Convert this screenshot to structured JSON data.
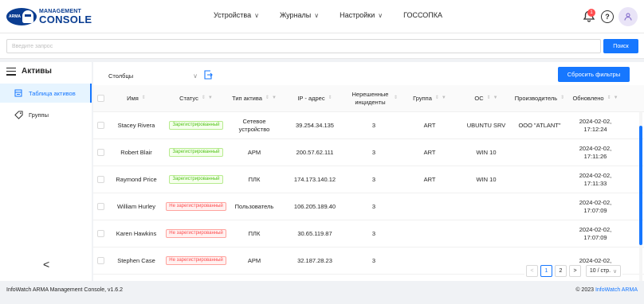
{
  "logo": {
    "line1": "MANAGEMENT",
    "line2": "CONSOLE",
    "badge": "ARMA"
  },
  "nav": [
    {
      "label": "Устройства",
      "has_dropdown": true
    },
    {
      "label": "Журналы",
      "has_dropdown": true
    },
    {
      "label": "Настройки",
      "has_dropdown": true
    },
    {
      "label": "ГОССОПКА",
      "has_dropdown": false
    }
  ],
  "header": {
    "notifications_count": "1",
    "help_icon": "question-circle-icon",
    "avatar_icon": "user-icon"
  },
  "search": {
    "placeholder": "Введите запрос",
    "value": "",
    "button_label": "Поиск"
  },
  "sidebar": {
    "title": "Активы",
    "items": [
      {
        "label": "Таблица активов",
        "icon": "table-icon",
        "active": true
      },
      {
        "label": "Группы",
        "icon": "tag-icon",
        "active": false
      }
    ],
    "collapse_label": "<"
  },
  "toolbar": {
    "columns_label": "Столбцы",
    "reset_label": "Сбросить фильтры"
  },
  "table": {
    "headers": [
      "Имя",
      "Статус",
      "Тип актива",
      "IP - адрес",
      "Нерешенные инциденты",
      "Группа",
      "ОС",
      "Производитель",
      "Обновлено"
    ],
    "rows": [
      {
        "name": "Stacey Rivera",
        "status": "Зарегистрированный",
        "status_kind": "ok",
        "type": "Сетевое устройство",
        "ip": "39.254.34.135",
        "incidents": "3",
        "group": "ART",
        "os": "UBUNTU SRV",
        "vendor": "ООО \"ATLANT\"",
        "updated_date": "2024-02-02,",
        "updated_time": "17:12:24"
      },
      {
        "name": "Robert Blair",
        "status": "Зарегистрированный",
        "status_kind": "ok",
        "type": "АРМ",
        "ip": "200.57.62.111",
        "incidents": "3",
        "group": "ART",
        "os": "WIN 10",
        "vendor": "",
        "updated_date": "2024-02-02,",
        "updated_time": "17:11:26"
      },
      {
        "name": "Raymond Price",
        "status": "Зарегистрированный",
        "status_kind": "ok",
        "type": "ПЛК",
        "ip": "174.173.140.12",
        "incidents": "3",
        "group": "ART",
        "os": "WIN 10",
        "vendor": "",
        "updated_date": "2024-02-02,",
        "updated_time": "17:11:33"
      },
      {
        "name": "William Hurley",
        "status": "Не зарегистрированный",
        "status_kind": "bad",
        "type": "Пользователь",
        "ip": "106.205.189.40",
        "incidents": "3",
        "group": "",
        "os": "",
        "vendor": "",
        "updated_date": "2024-02-02,",
        "updated_time": "17:07:09"
      },
      {
        "name": "Karen Hawkins",
        "status": "Не зарегистрированный",
        "status_kind": "bad",
        "type": "ПЛК",
        "ip": "30.65.119.87",
        "incidents": "3",
        "group": "",
        "os": "",
        "vendor": "",
        "updated_date": "2024-02-02,",
        "updated_time": "17:07:09"
      },
      {
        "name": "Stephen Case",
        "status": "Не зарегистрированный",
        "status_kind": "bad",
        "type": "АРМ",
        "ip": "32.187.28.23",
        "incidents": "3",
        "group": "",
        "os": "",
        "vendor": "",
        "updated_date": "2024-02-02,",
        "updated_time": ""
      }
    ]
  },
  "pagination": {
    "prev": "<",
    "pages": [
      "1",
      "2"
    ],
    "current": "1",
    "next": ">",
    "page_size": "10 / стр."
  },
  "footer": {
    "left": "InfoWatch ARMA Management Console, v1.6.2",
    "right_prefix": "© 2023 ",
    "right_link": "InfoWatch ARMA"
  },
  "colors": {
    "accent": "#1677ff",
    "logo": "#0a3d91",
    "ok": "#52c41a",
    "bad": "#ff4d4f"
  }
}
